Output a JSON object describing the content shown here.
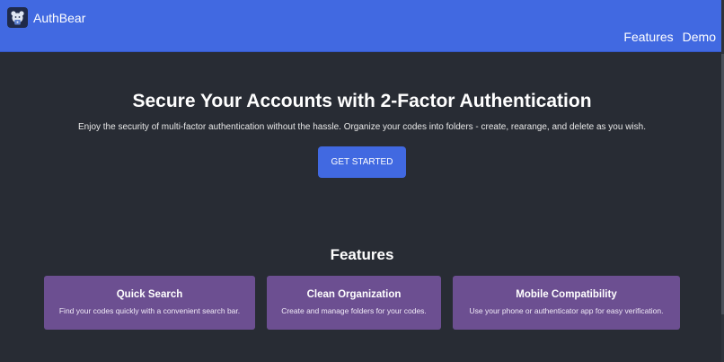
{
  "navbar": {
    "brand": "AuthBear",
    "links": [
      "Features",
      "Demo"
    ]
  },
  "hero": {
    "title": "Secure Your Accounts with 2-Factor Authentication",
    "subtitle": "Enjoy the security of multi-factor authentication without the hassle. Organize your codes into folders - create, rearange, and delete as you wish.",
    "cta_label": "GET STARTED"
  },
  "features": {
    "heading": "Features",
    "cards": [
      {
        "title": "Quick Search",
        "description": "Find your codes quickly with a convenient search bar."
      },
      {
        "title": "Clean Organization",
        "description": "Create and manage folders for your codes."
      },
      {
        "title": "Mobile Compatibility",
        "description": "Use your phone or authenticator app for easy verification."
      }
    ]
  },
  "colors": {
    "navbar": "#4169e1",
    "background": "#282c34",
    "card": "#6c4f91",
    "button": "#4169e1"
  },
  "icons": {
    "logo": "bear-logo-icon"
  }
}
